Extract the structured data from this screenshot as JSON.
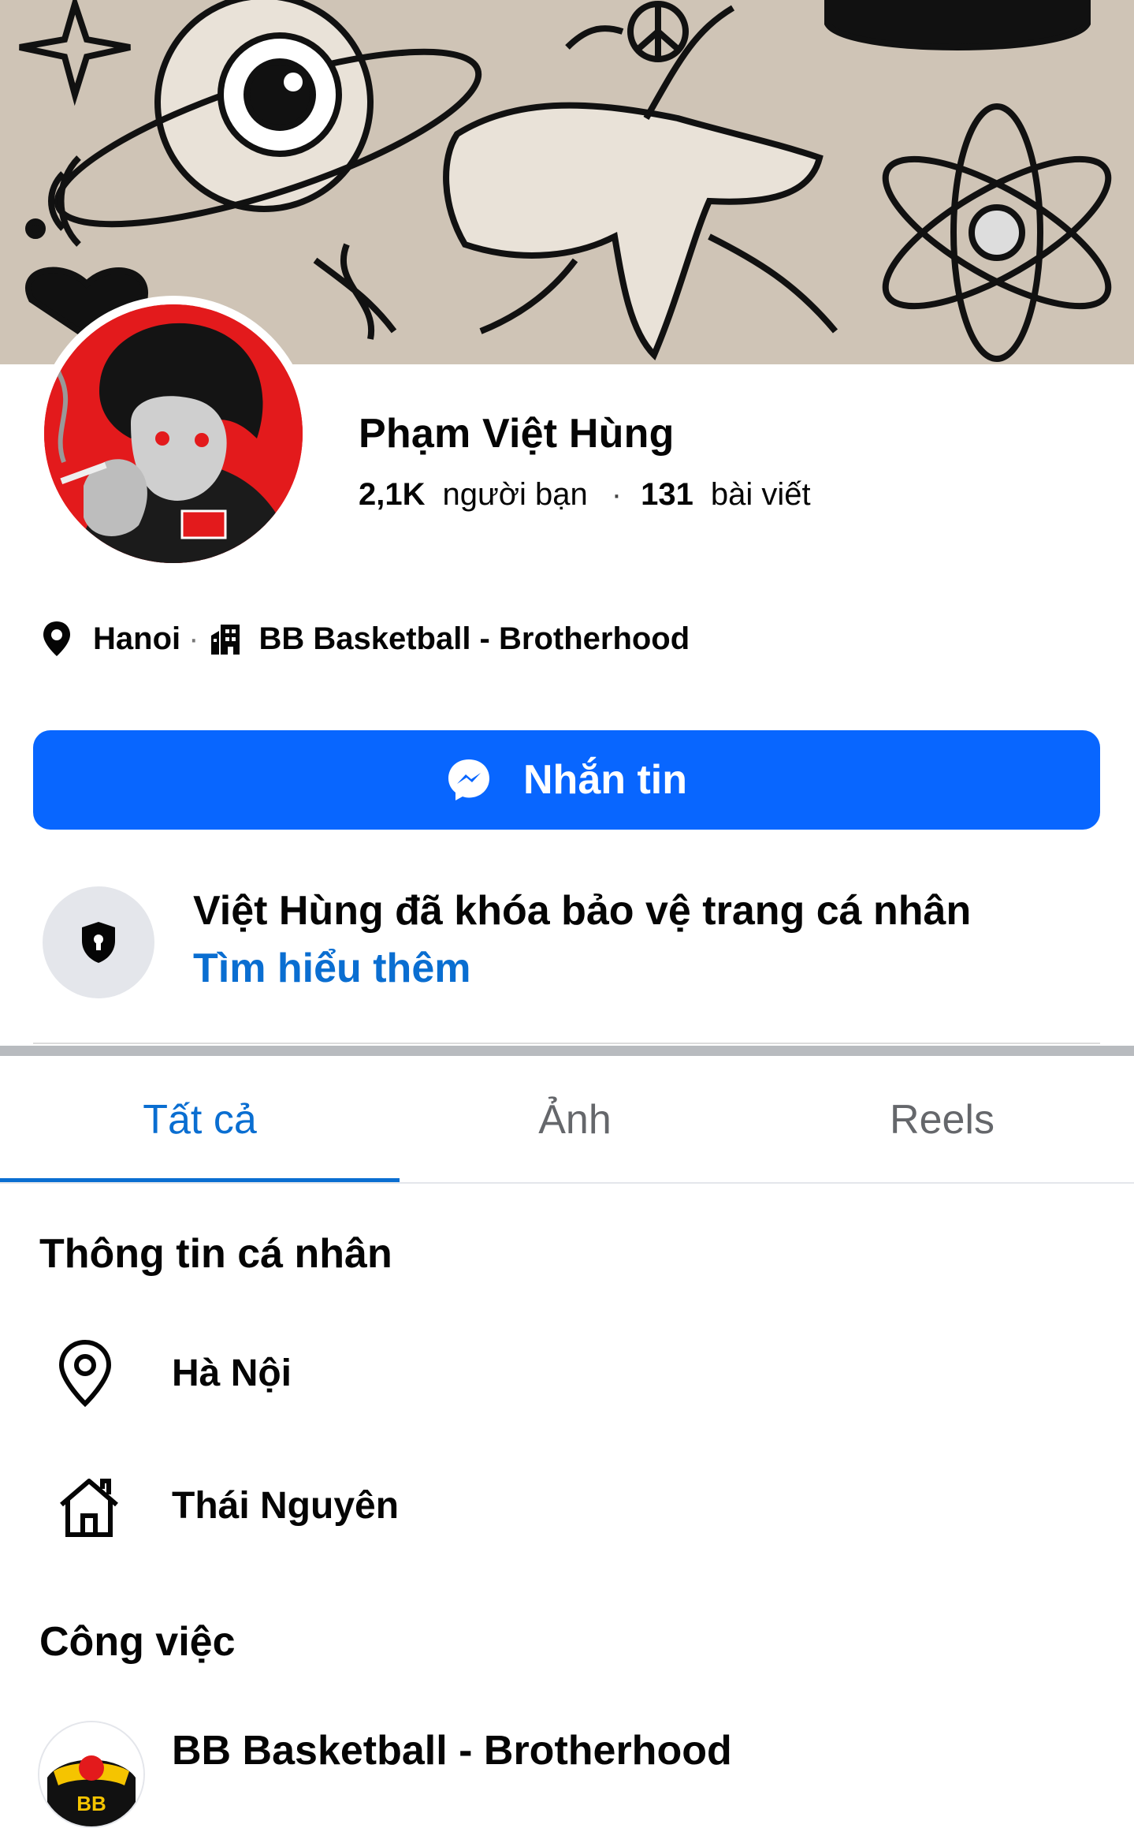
{
  "profile": {
    "name": "Phạm Việt Hùng",
    "friends_count": "2,1K",
    "friends_label": "người bạn",
    "separator": "·",
    "posts_count": "131",
    "posts_label": "bài viết"
  },
  "meta": {
    "location": "Hanoi",
    "workplace": "BB Basketball - Brotherhood"
  },
  "actions": {
    "message_label": "Nhắn tin"
  },
  "lock_notice": {
    "title": "Việt Hùng đã khóa bảo vệ trang cá nhân",
    "link": "Tìm hiểu thêm"
  },
  "tabs": [
    {
      "label": "Tất cả",
      "active": true
    },
    {
      "label": "Ảnh",
      "active": false
    },
    {
      "label": "Reels",
      "active": false
    }
  ],
  "personal_info": {
    "title": "Thông tin cá nhân",
    "current_city": "Hà Nội",
    "hometown": "Thái Nguyên"
  },
  "work": {
    "title": "Công việc",
    "employer": "BB Basketball - Brotherhood"
  },
  "colors": {
    "brand_blue": "#0866ff",
    "link_blue": "#0a6ed1",
    "cover_beige": "#cfc4b6",
    "avatar_red": "#e31a1c"
  }
}
